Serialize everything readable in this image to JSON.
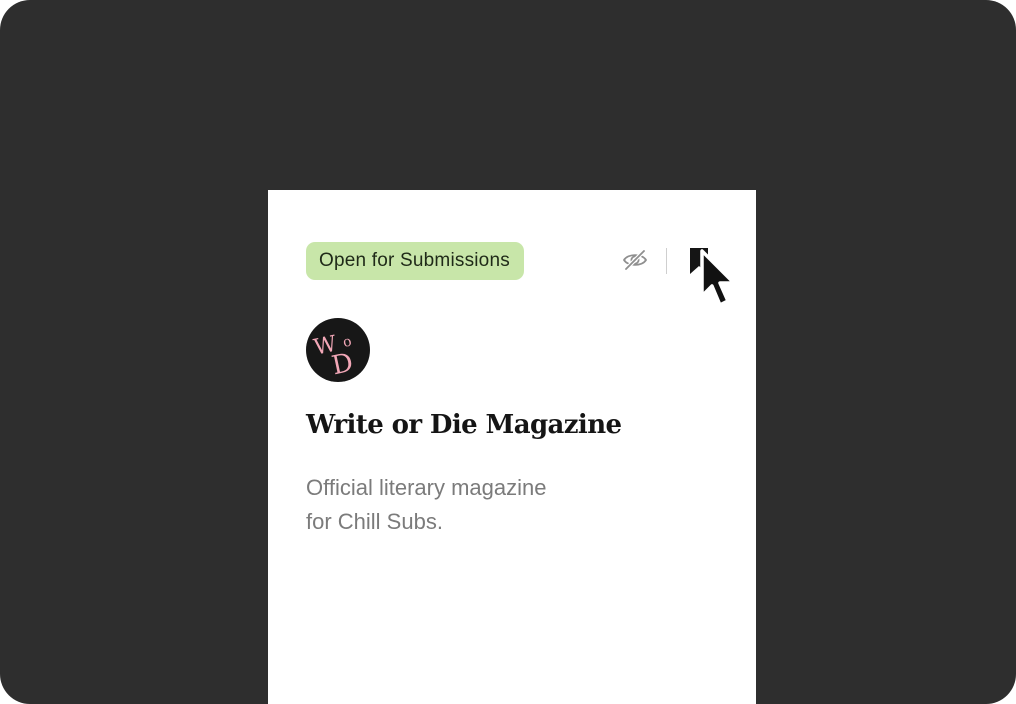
{
  "card": {
    "status_badge": "Open for Submissions",
    "title": "Write or Die Magazine",
    "description_line1": "Official literary magazine",
    "description_line2": "for Chill Subs."
  },
  "icons": {
    "hide": "eye-slash-icon",
    "bookmark": "bookmark-icon",
    "logo": "wod-monogram-logo",
    "cursor": "mouse-pointer-icon"
  },
  "colors": {
    "background": "#2e2e2e",
    "card": "#ffffff",
    "badge_bg": "#c8e6a9",
    "title": "#151515",
    "description": "#7b7b7b",
    "logo_bg": "#171717",
    "logo_letters": "#f2a7b7"
  }
}
